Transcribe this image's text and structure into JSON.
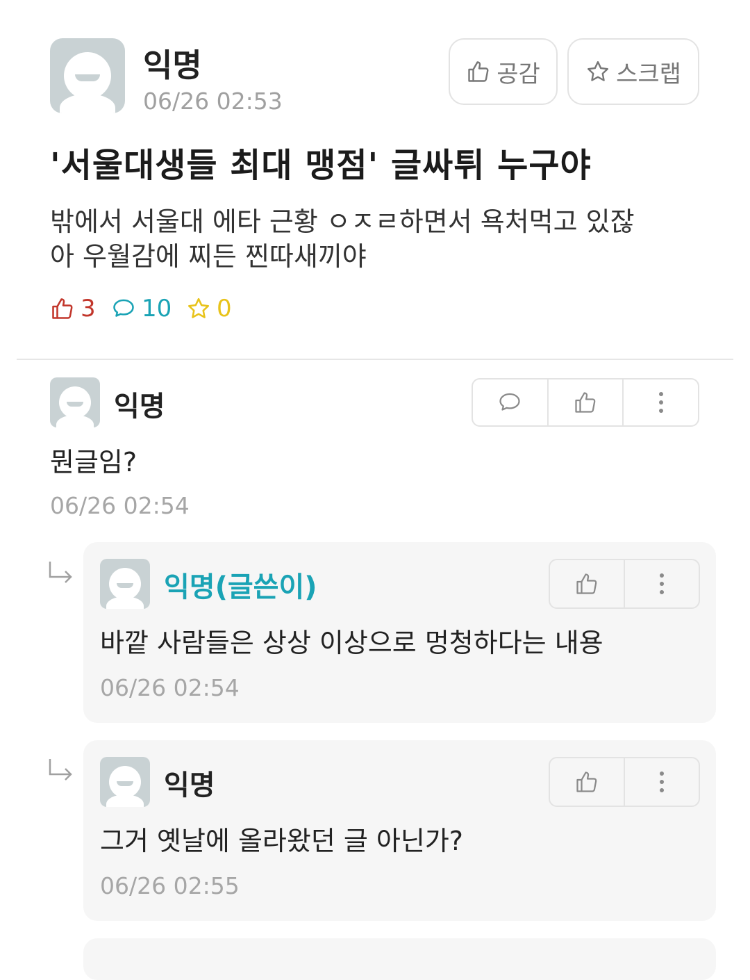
{
  "post": {
    "author": "익명",
    "time": "06/26 02:53",
    "like_button": "공감",
    "scrap_button": "스크랩",
    "title": "'서울대생들 최대 맹점' 글싸튀 누구야",
    "body_line1": "밖에서 서울대 에타 근황 ㅇㅈㄹ하면서 욕처먹고 있잖",
    "body_line2": "아 우월감에 찌든 찐따새끼야",
    "likes": "3",
    "comments": "10",
    "scraps": "0"
  },
  "comments": [
    {
      "author": "익명",
      "text": "뭔글임?",
      "time": "06/26 02:54",
      "is_op": false,
      "is_reply": false
    },
    {
      "author": "익명(글쓴이)",
      "text": "바깥 사람들은 상상 이상으로 멍청하다는 내용",
      "time": "06/26 02:54",
      "is_op": true,
      "is_reply": true
    },
    {
      "author": "익명",
      "text": "그거 옛날에 올라왔던 글 아닌가?",
      "time": "06/26 02:55",
      "is_op": false,
      "is_reply": true
    }
  ],
  "colors": {
    "like": "#c2362b",
    "comment": "#1aa3b5",
    "scrap": "#e8c31a",
    "op_author": "#1aa3b5"
  },
  "icons": [
    "thumbs-up-icon",
    "star-icon",
    "speech-bubble-icon",
    "more-vertical-icon",
    "reply-arrow-icon",
    "avatar-icon"
  ]
}
